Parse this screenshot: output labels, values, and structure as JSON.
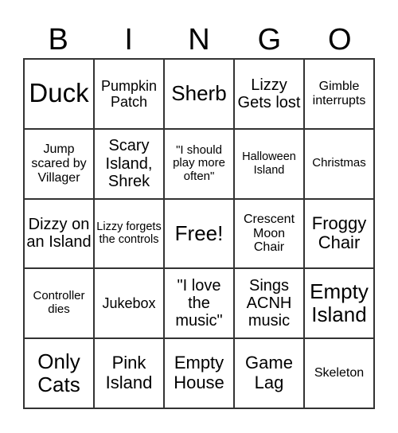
{
  "header": {
    "letters": [
      "B",
      "I",
      "N",
      "G",
      "O"
    ]
  },
  "board": {
    "cells": [
      [
        "Duck",
        "Pumpkin Patch",
        "Sherb",
        "Lizzy Gets lost",
        "Gimble interrupts"
      ],
      [
        "Jump scared by Villager",
        "Scary Island, Shrek",
        "\"I should play more often\"",
        "Halloween Island",
        "Christmas"
      ],
      [
        "Dizzy on an Island",
        "Lizzy forgets the controls",
        "Free!",
        "Crescent Moon Chair",
        "Froggy Chair"
      ],
      [
        "Controller dies",
        "Jukebox",
        "\"I love the music\"",
        "Sings ACNH music",
        "Empty Island"
      ],
      [
        "Only Cats",
        "Pink Island",
        "Empty House",
        "Game Lag",
        "Skeleton"
      ]
    ]
  }
}
